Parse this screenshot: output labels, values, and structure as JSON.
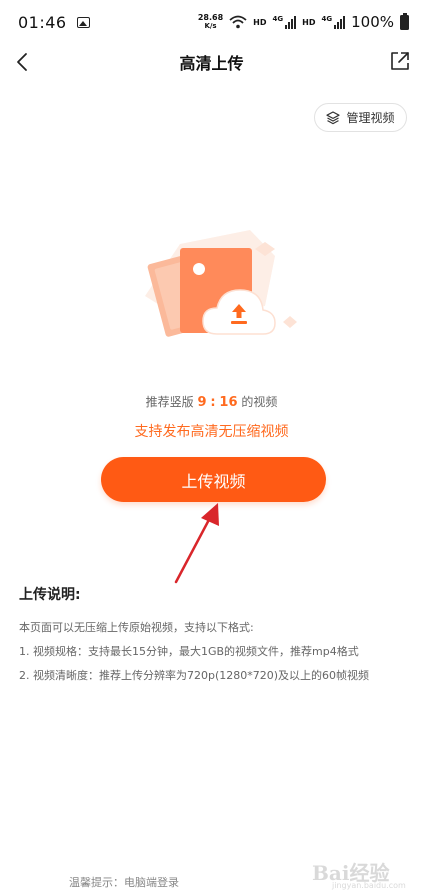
{
  "status_bar": {
    "time": "01:46",
    "net_speed_value": "28.68",
    "net_speed_unit": "K/s",
    "hd1": "HD",
    "net1": "4G",
    "hd2": "HD",
    "net2": "4G",
    "battery": "100%"
  },
  "nav": {
    "title": "高清上传"
  },
  "manage_label": "管理视频",
  "ratio": {
    "prefix": "推荐竖版",
    "w": "9",
    "sep": ":",
    "h": "16",
    "suffix": "的视频"
  },
  "feature_text": "支持发布高清无压缩视频",
  "upload_button": "上传视频",
  "instructions": {
    "title": "上传说明:",
    "lines": [
      "本页面可以无压缩上传原始视频，支持以下格式:",
      "1. 视频规格：支持最长15分钟，最大1GB的视频文件，推荐mp4格式",
      "2. 视频清晰度：推荐上传分辨率为720p(1280*720)及以上的60帧视频"
    ]
  },
  "bottom_tip": "温馨提示：电脑端登录",
  "watermark": {
    "text": "Bai经验",
    "sub": "jingyan.baidu.com"
  },
  "colors": {
    "accent": "#ff5a14",
    "accent_text": "#ff6a1f",
    "annotation_arrow": "#d9262b"
  },
  "icons": {
    "back": "chevron-left-icon",
    "share": "external-share-icon",
    "manage": "layers-icon",
    "upload_cloud": "cloud-upload-icon"
  }
}
